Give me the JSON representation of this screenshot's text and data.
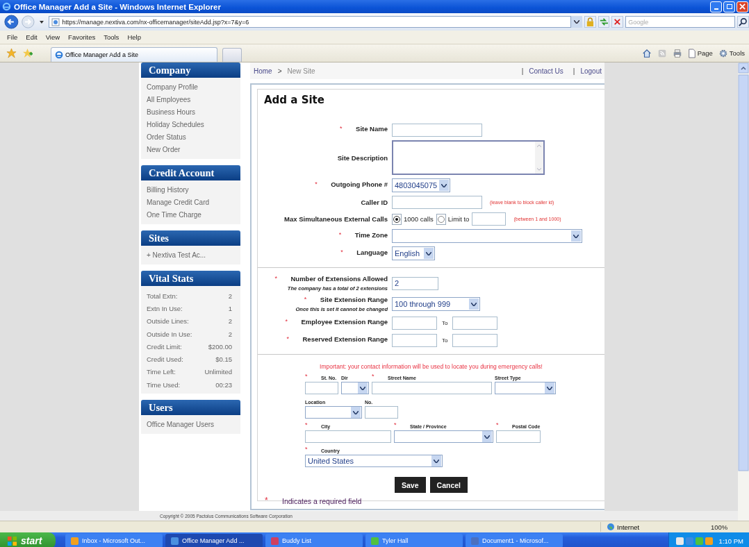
{
  "browser": {
    "title": "Office Manager Add a Site - Windows Internet Explorer",
    "address": "https://manage.nextiva.com/nx-officemanager/siteAdd.jsp?x=7&y=6",
    "search_placeholder": "Google",
    "menu": [
      "File",
      "Edit",
      "View",
      "Favorites",
      "Tools",
      "Help"
    ],
    "tab": "Office Manager Add a Site",
    "commands": [
      "Page",
      "Tools"
    ]
  },
  "sidebar": [
    {
      "kind": "links",
      "title": "Company",
      "items": [
        "Company Profile",
        "All Employees",
        "Business Hours",
        "Holiday Schedules",
        "Order Status",
        "New Order"
      ]
    },
    {
      "kind": "links",
      "title": "Credit Account",
      "items": [
        "Billing History",
        "Manage Credit Card",
        "One Time Charge"
      ]
    },
    {
      "kind": "links",
      "title": "Sites",
      "items": [
        "+ Nextiva Test Ac..."
      ]
    },
    {
      "kind": "stats",
      "title": "Vital Stats",
      "items": [
        {
          "label": "Total Extn:",
          "value": "2"
        },
        {
          "label": "Extn In Use:",
          "value": "1"
        },
        {
          "label": "Outside Lines:",
          "value": "2"
        },
        {
          "label": "Outside In Use:",
          "value": "2"
        },
        {
          "label": "Credit Limit:",
          "value": "$200.00"
        },
        {
          "label": "Credit Used:",
          "value": "$0.15"
        },
        {
          "label": "Time Left:",
          "value": "Unlimited"
        },
        {
          "label": "Time Used:",
          "value": "00:23"
        }
      ]
    },
    {
      "kind": "links",
      "title": "Users",
      "items": [
        "Office Manager Users"
      ]
    }
  ],
  "breadcrumb": {
    "items": [
      "Home",
      "New Site"
    ],
    "separator": ">",
    "divider": "|",
    "links": [
      "Contact Us",
      "Logout"
    ]
  },
  "form": {
    "title": "Add a Site",
    "required_mark": "*",
    "sections": [
      {
        "kind": "fields",
        "rows": [
          {
            "kind": "text",
            "label": "Site Name",
            "required": true
          },
          {
            "kind": "textarea",
            "label": "Site Description",
            "required": false
          },
          {
            "kind": "select",
            "label": "Outgoing Phone #",
            "required": true,
            "value": "4803045075"
          },
          {
            "kind": "text",
            "label": "Caller ID",
            "required": false,
            "hint": "(leave blank to block caller id)"
          },
          {
            "kind": "radio",
            "label": "Max Simultaneous External Calls",
            "required": false,
            "options": [
              {
                "label": "1000 calls",
                "selected": true
              },
              {
                "label": "Limit to",
                "selected": false
              }
            ],
            "hint": "(between 1 and 1000)"
          },
          {
            "kind": "select",
            "label": "Time Zone",
            "required": true
          },
          {
            "kind": "select",
            "label": "Language",
            "required": true,
            "value": "English"
          }
        ]
      },
      {
        "kind": "fields",
        "rows": [
          {
            "kind": "text",
            "label": "Number of Extensions Allowed",
            "required": true,
            "note": "The company has a total of 2 extensions",
            "value": "2"
          },
          {
            "kind": "select",
            "label": "Site Extension Range",
            "required": true,
            "note": "Once this is set it cannot be changed",
            "value": "100 through 999"
          },
          {
            "kind": "range",
            "label": "Employee Extension Range",
            "required": true,
            "to": "To"
          },
          {
            "kind": "range",
            "label": "Reserved Extension Range",
            "required": true,
            "to": "To"
          }
        ]
      },
      {
        "kind": "address",
        "notice": "Important: your contact information will be used to locate you during emergency calls!",
        "rows": [
          [
            {
              "kind": "text",
              "label": "St. No.",
              "required": true
            },
            {
              "kind": "select",
              "label": "Dir",
              "required": false
            },
            {
              "kind": "text",
              "label": "Street Name",
              "required": true
            },
            {
              "kind": "select",
              "label": "Street Type",
              "required": false
            }
          ],
          [
            {
              "kind": "select",
              "label": "Location",
              "required": false
            },
            {
              "kind": "text",
              "label": "No.",
              "required": false
            }
          ],
          [
            {
              "kind": "text",
              "label": "City",
              "required": true
            },
            {
              "kind": "select",
              "label": "State / Province",
              "required": true
            },
            {
              "kind": "text",
              "label": "Postal Code",
              "required": true
            }
          ],
          [
            {
              "kind": "select",
              "label": "Country",
              "required": true,
              "value": "United States"
            }
          ]
        ]
      }
    ],
    "buttons": [
      "Save",
      "Cancel"
    ],
    "required_note": "Indicates a required field"
  },
  "footer": "Copyright © 2005 Pactolus Communications Software Corporation",
  "status_bar": {
    "zone": "Internet",
    "zoom": "100%"
  },
  "taskbar": {
    "start": "start",
    "tasks": [
      {
        "label": "Inbox - Microsoft Out...",
        "selected": false
      },
      {
        "label": "Office Manager Add ...",
        "selected": true
      },
      {
        "label": "Buddy List",
        "selected": false
      },
      {
        "label": "Tyler Hall",
        "selected": false
      },
      {
        "label": "Document1 - Microsof...",
        "selected": false
      }
    ],
    "clock": "1:10 PM"
  }
}
